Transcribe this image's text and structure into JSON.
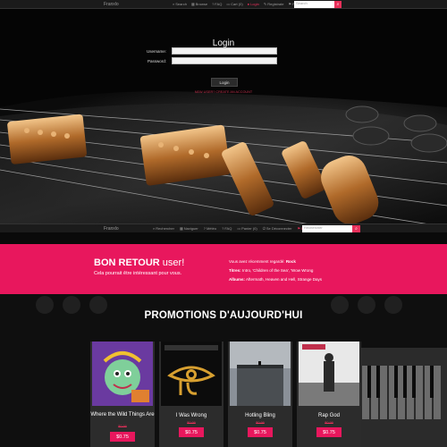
{
  "topnav": {
    "brand": "Franxlo",
    "links": [
      {
        "icon": "search-icon",
        "glyph": "⌕",
        "label": "Search"
      },
      {
        "icon": "browse-icon",
        "glyph": "▦",
        "label": "Browse"
      },
      {
        "icon": "faq-icon",
        "glyph": "?",
        "label": "FAQ"
      },
      {
        "icon": "cart-icon",
        "glyph": "🛒",
        "label": "Cart (0)"
      },
      {
        "icon": "login-icon",
        "glyph": "●",
        "label": "Login"
      },
      {
        "icon": "register-icon",
        "glyph": "✎",
        "label": "Registrate"
      },
      {
        "icon": "language-icon",
        "glyph": "⚑",
        "label": "Fr"
      }
    ],
    "search_placeholder": "Search",
    "search_button": "⌕"
  },
  "login": {
    "title": "Login",
    "username_label": "Username:",
    "password_label": "Password:",
    "button": "Login",
    "signup": "NEW USER? CREATE AN ACCOUNT"
  },
  "subnav": {
    "brand": "Franxlo",
    "links": [
      {
        "icon": "search-icon",
        "glyph": "⌕",
        "label": "Rechercher"
      },
      {
        "icon": "browse-icon",
        "glyph": "▦",
        "label": "Naviguer"
      },
      {
        "icon": "faq-icon",
        "glyph": "?",
        "label": "Météo"
      },
      {
        "icon": "faq-icon",
        "glyph": "?",
        "label": "FAQ"
      },
      {
        "icon": "cart-icon",
        "glyph": "🛒",
        "label": "Panier (0)"
      },
      {
        "icon": "logout-icon",
        "glyph": "⏻",
        "label": "Se Déconnecter"
      },
      {
        "icon": "language-icon",
        "glyph": "⚑",
        "label": "En"
      }
    ],
    "search_placeholder": "Rechercher",
    "search_button": "⌕"
  },
  "welcome": {
    "title_bold": "BON RETOUR",
    "title_light": " user!",
    "subtitle": "Cela pourrait être intéressant pour vous.",
    "recent_prefix": "Vous avez récemment regardé:",
    "recent_value": "Rock",
    "titres_label": "Titres:",
    "titres_value": "Intro, 'Children of the Sea', 'Wow Wrong",
    "albums_label": "Albums:",
    "albums_value": "Aftermath, Heaven and Hell, Strange Days"
  },
  "promotions": {
    "title": "PROMOTIONS D'AUJOURD'HUI",
    "items": [
      {
        "name": "Where the Wild Things Are",
        "old_price": "$0.99",
        "price": "$0.75"
      },
      {
        "name": "I Was Wrong",
        "old_price": "$0.99",
        "price": "$0.75"
      },
      {
        "name": "Hotling Bling",
        "old_price": "$0.99",
        "price": "$0.75"
      },
      {
        "name": "Rap God",
        "old_price": "$0.99",
        "price": "$0.75"
      }
    ]
  },
  "colors": {
    "accent": "#e8175d",
    "nav_bg": "#1b1b1b"
  }
}
